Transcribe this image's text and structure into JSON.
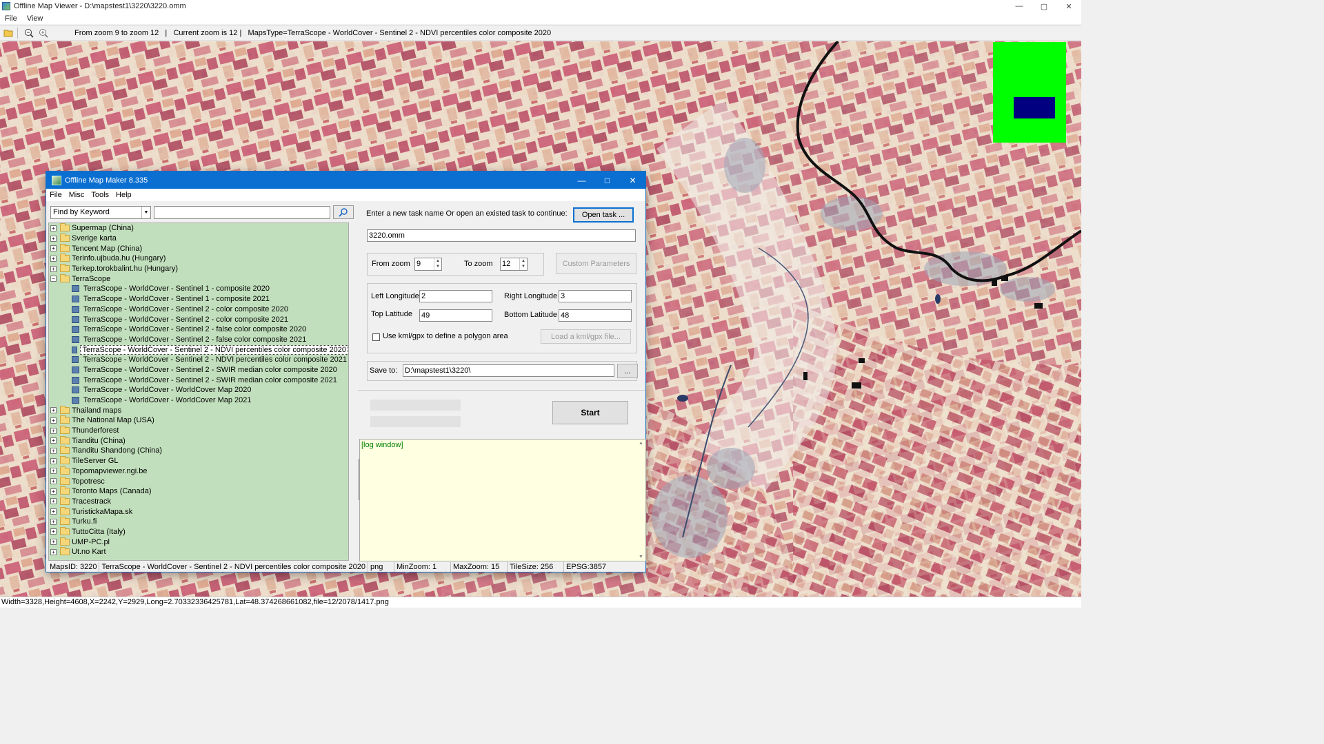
{
  "window": {
    "title": "Offline Map Viewer - D:\\mapstest1\\3220\\3220.omm",
    "controls": [
      "—",
      "▢",
      "✕"
    ]
  },
  "menu": [
    "File",
    "View"
  ],
  "toolbar": {
    "info": "From zoom 9 to zoom 12   |   Current zoom is 12 |   MapsType=TerraScope - WorldCover - Sentinel 2 - NDVI percentiles color composite 2020"
  },
  "statusbar": "Width=3328,Height=4608,X=2242,Y=2929,Long=2.70332336425781,Lat=48.374268661082,file=12/2078/1417.png",
  "overview_colors": {
    "background": "#00ff00",
    "viewport": "#000080"
  },
  "dialog": {
    "title": "Offline Map Maker 8.335",
    "controls": [
      "—",
      "□",
      "✕"
    ],
    "menu": [
      "File",
      "Misc",
      "Tools",
      "Help"
    ],
    "search": {
      "mode": "Find by Keyword",
      "value": ""
    },
    "tree": [
      {
        "label": "Supermap (China)",
        "type": "folder",
        "exp": "+"
      },
      {
        "label": "Sverige karta",
        "type": "folder",
        "exp": "+"
      },
      {
        "label": "Tencent Map (China)",
        "type": "folder",
        "exp": "+"
      },
      {
        "label": "Terinfo.ujbuda.hu (Hungary)",
        "type": "folder",
        "exp": "+"
      },
      {
        "label": "Terkep.torokbalint.hu (Hungary)",
        "type": "folder",
        "exp": "+"
      },
      {
        "label": "TerraScope",
        "type": "folder",
        "exp": "−"
      },
      {
        "label": "TerraScope - WorldCover - Sentinel 1 - composite 2020",
        "type": "map"
      },
      {
        "label": "TerraScope - WorldCover - Sentinel 1 - composite 2021",
        "type": "map"
      },
      {
        "label": "TerraScope - WorldCover - Sentinel 2 - color composite 2020",
        "type": "map"
      },
      {
        "label": "TerraScope - WorldCover - Sentinel 2 - color composite 2021",
        "type": "map"
      },
      {
        "label": "TerraScope - WorldCover - Sentinel 2 - false color composite 2020",
        "type": "map"
      },
      {
        "label": "TerraScope - WorldCover - Sentinel 2 - false color composite 2021",
        "type": "map"
      },
      {
        "label": "TerraScope - WorldCover - Sentinel 2 - NDVI percentiles color composite 2020",
        "type": "map",
        "selected": true
      },
      {
        "label": "TerraScope - WorldCover - Sentinel 2 - NDVI percentiles color composite 2021",
        "type": "map"
      },
      {
        "label": "TerraScope - WorldCover - Sentinel 2 - SWIR median color composite 2020",
        "type": "map"
      },
      {
        "label": "TerraScope - WorldCover - Sentinel 2 - SWIR median color composite 2021",
        "type": "map"
      },
      {
        "label": "TerraScope - WorldCover - WorldCover Map 2020",
        "type": "map"
      },
      {
        "label": "TerraScope - WorldCover - WorldCover Map 2021",
        "type": "map"
      },
      {
        "label": "Thailand maps",
        "type": "folder",
        "exp": "+"
      },
      {
        "label": "The National Map (USA)",
        "type": "folder",
        "exp": "+"
      },
      {
        "label": "Thunderforest",
        "type": "folder",
        "exp": "+"
      },
      {
        "label": "Tianditu (China)",
        "type": "folder",
        "exp": "+"
      },
      {
        "label": "Tianditu Shandong (China)",
        "type": "folder",
        "exp": "+"
      },
      {
        "label": "TileServer GL",
        "type": "folder",
        "exp": "+"
      },
      {
        "label": "Topomapviewer.ngi.be",
        "type": "folder",
        "exp": "+"
      },
      {
        "label": "Topotresc",
        "type": "folder",
        "exp": "+"
      },
      {
        "label": "Toronto Maps (Canada)",
        "type": "folder",
        "exp": "+"
      },
      {
        "label": "Tracestrack",
        "type": "folder",
        "exp": "+"
      },
      {
        "label": "TuristickaMapa.sk",
        "type": "folder",
        "exp": "+"
      },
      {
        "label": "Turku.fi",
        "type": "folder",
        "exp": "+"
      },
      {
        "label": "TuttoCitta (Italy)",
        "type": "folder",
        "exp": "+"
      },
      {
        "label": "UMP-PC.pl",
        "type": "folder",
        "exp": "+"
      },
      {
        "label": "Ut.no Kart",
        "type": "folder",
        "exp": "+"
      }
    ],
    "task": {
      "prompt": "Enter a new task name Or open an existed task to continue:",
      "open_button": "Open task ...",
      "name": "3220.omm",
      "from_zoom_label": "From zoom",
      "from_zoom": "9",
      "to_zoom_label": "To zoom",
      "to_zoom": "12",
      "custom_button": "Custom Parameters",
      "left_lon_label": "Left Longitude",
      "left_lon": "2",
      "right_lon_label": "Right Longitude",
      "right_lon": "3",
      "top_lat_label": "Top Latitude",
      "top_lat": "49",
      "bottom_lat_label": "Bottom Latitude",
      "bottom_lat": "48",
      "kml_label": "Use kml/gpx to define a polygon area",
      "kml_button": "Load a kml/gpx file...",
      "save_label": "Save to:",
      "save_path": "D:\\mapstest1\\3220\\",
      "browse_button": "...",
      "start_button": "Start",
      "log_text": "[log window]"
    },
    "status": {
      "maps_id": "MapsID: 3220",
      "name": "TerraScope - WorldCover - Sentinel 2 - NDVI percentiles color composite 2020",
      "format": "png",
      "min_zoom": "MinZoom: 1",
      "max_zoom": "MaxZoom: 15",
      "tile_size": "TileSize: 256",
      "epsg": "EPSG:3857"
    }
  }
}
